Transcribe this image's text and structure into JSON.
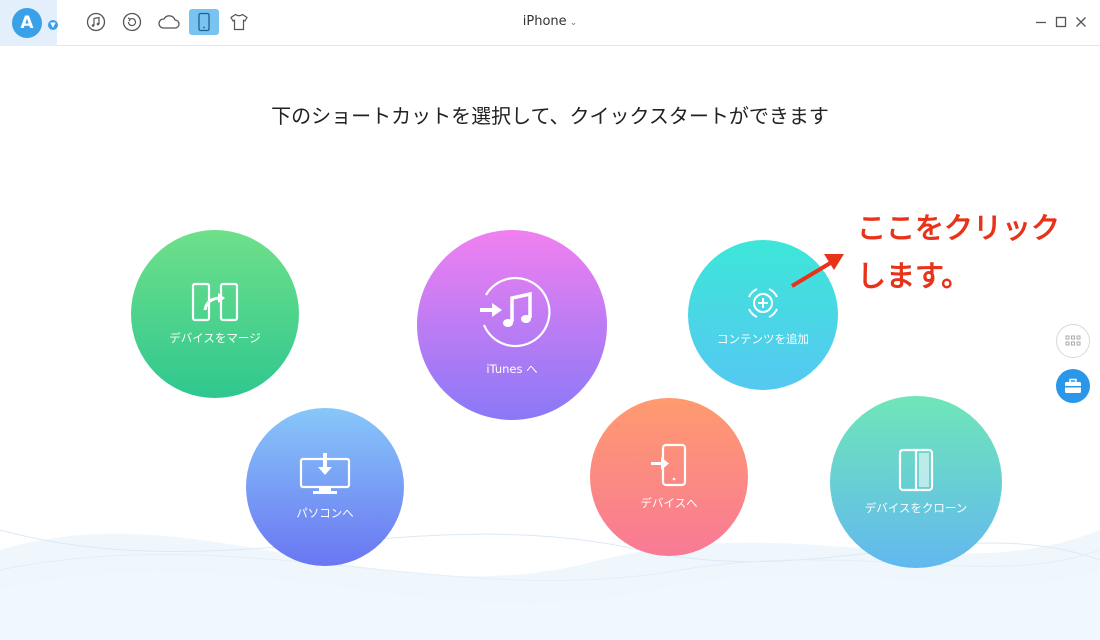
{
  "titlebar": {
    "device_name": "iPhone",
    "logo_letter": "A",
    "icons": [
      "music-icon",
      "restore-icon",
      "cloud-icon",
      "phone-icon",
      "tshirt-icon"
    ],
    "active_icon": "phone-icon"
  },
  "window_controls": [
    "minimize-icon",
    "maximize-icon",
    "close-icon"
  ],
  "headline": "下のショートカットを選択して、クイックスタートができます",
  "shortcuts": {
    "merge": {
      "label": "デバイスをマージ",
      "icon": "merge-icon"
    },
    "itunes": {
      "label": "iTunes へ",
      "icon": "itunes-transfer-icon"
    },
    "add": {
      "label": "コンテンツを追加",
      "icon": "add-content-icon"
    },
    "pc": {
      "label": "パソコンへ",
      "icon": "computer-download-icon"
    },
    "device": {
      "label": "デバイスへ",
      "icon": "phone-transfer-icon"
    },
    "clone": {
      "label": "デバイスをクローン",
      "icon": "clone-icon"
    }
  },
  "annotation": {
    "line1": "ここをクリック",
    "line2": "します。",
    "color": "#e8331a"
  },
  "side_buttons": [
    "grid-icon",
    "toolbox-icon"
  ],
  "colors": {
    "accent": "#3aa0e8",
    "merge": [
      "#6fe08a",
      "#2fc78f"
    ],
    "itunes": [
      "#f180f0",
      "#8a78f7"
    ],
    "add": [
      "#3de6d8",
      "#55c8f2"
    ],
    "pc": [
      "#87c7f9",
      "#6a76f2"
    ],
    "device": [
      "#ff9a6e",
      "#f87a96"
    ],
    "clone": [
      "#6fe6b8",
      "#62b8ef"
    ]
  }
}
